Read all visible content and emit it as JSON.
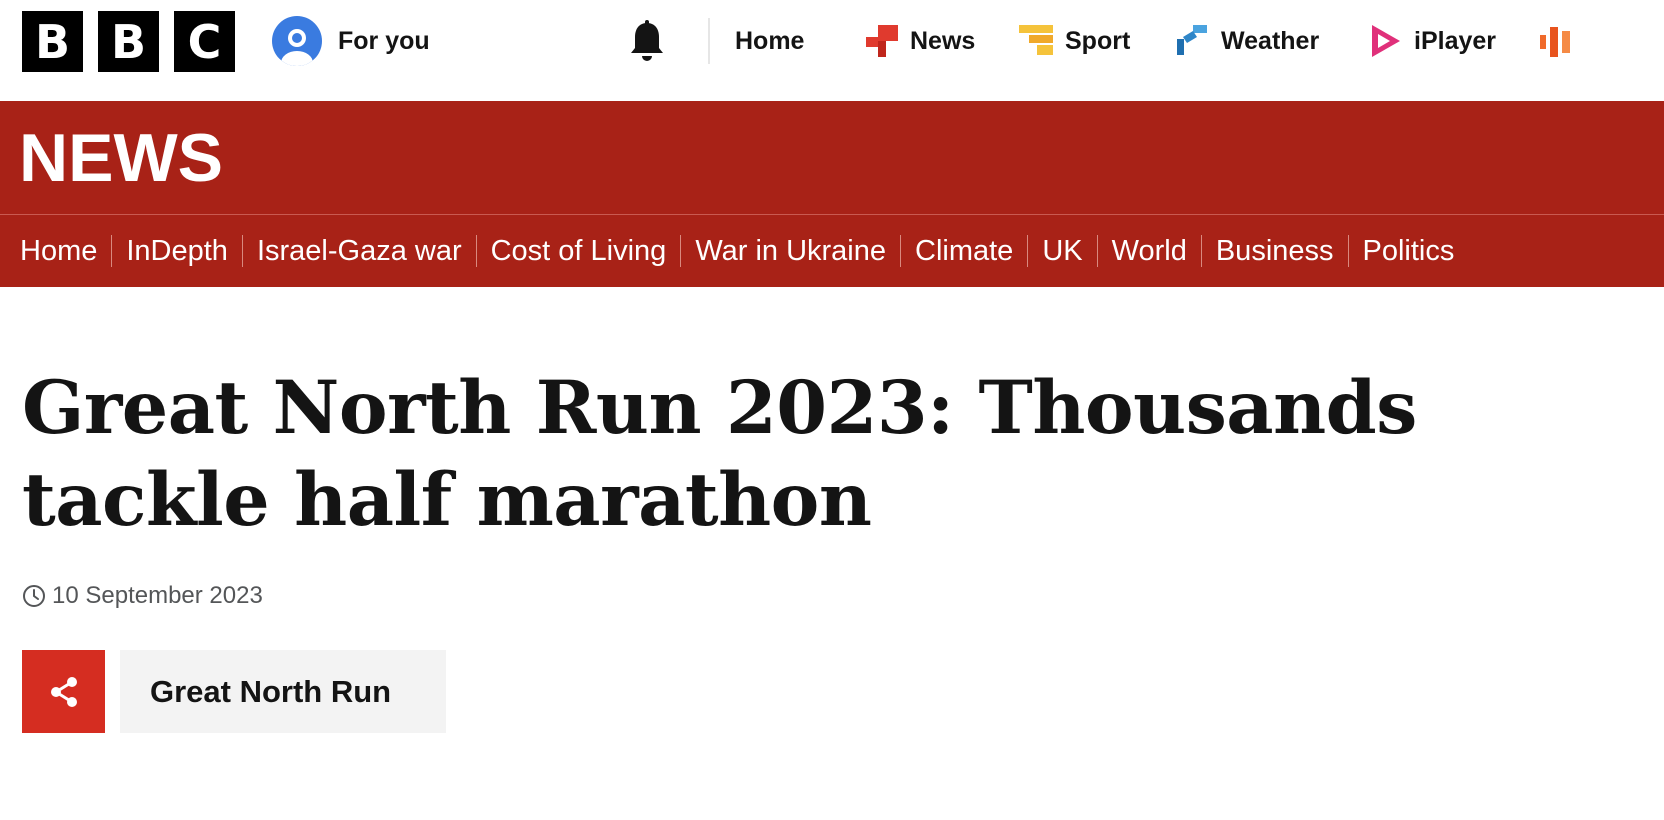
{
  "brand": {
    "logo_letters": [
      "B",
      "B",
      "C"
    ]
  },
  "topbar": {
    "for_you_label": "For you",
    "nav": [
      {
        "label": "Home",
        "icon": "none"
      },
      {
        "label": "News",
        "icon": "news-blocks-icon",
        "color": "#e03a2e"
      },
      {
        "label": "Sport",
        "icon": "sport-bars-icon",
        "color": "#f5c33b"
      },
      {
        "label": "Weather",
        "icon": "weather-icon",
        "color": "#2f86c8"
      },
      {
        "label": "iPlayer",
        "icon": "iplayer-play-icon",
        "color": "#e0307a"
      },
      {
        "label": "",
        "icon": "sounds-icon",
        "color": "#f06a2a"
      }
    ]
  },
  "masthead": {
    "title": "NEWS",
    "color": "#a82217"
  },
  "section_nav": [
    "Home",
    "InDepth",
    "Israel-Gaza war",
    "Cost of Living",
    "War in Ukraine",
    "Climate",
    "UK",
    "World",
    "Business",
    "Politics"
  ],
  "article": {
    "headline": "Great North Run 2023: Thousands tackle half marathon",
    "date": "10 September 2023",
    "topic_tag": "Great North Run",
    "share_color": "#d52d21"
  }
}
